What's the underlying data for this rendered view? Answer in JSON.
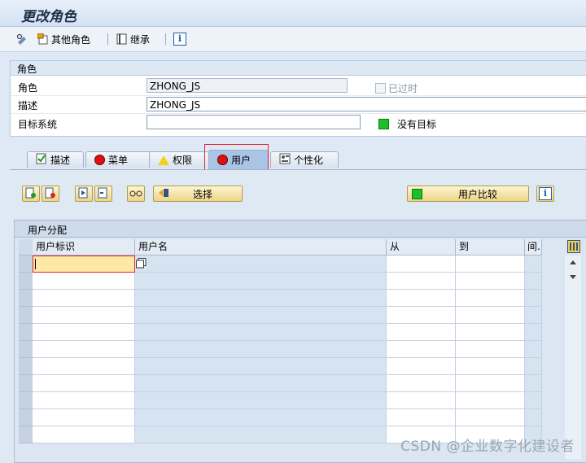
{
  "window": {
    "title": "更改角色"
  },
  "toolbar": {
    "other_role_label": "其他角色",
    "inherit_label": "继承",
    "icons": [
      "display-change-icon",
      "other-role-icon",
      "inherit-icon",
      "info-icon"
    ]
  },
  "role_section": {
    "header": "角色",
    "role_label": "角色",
    "role_value": "ZHONG_JS",
    "obsolete_label": "已过时",
    "desc_label": "描述",
    "desc_value": "ZHONG_JS",
    "target_label": "目标系统",
    "target_value": "",
    "no_target_label": "没有目标",
    "status_color": "#1ec02a"
  },
  "tabs": [
    {
      "label": "描述",
      "icon": "document-check-icon"
    },
    {
      "label": "菜单",
      "icon": "red-light-icon"
    },
    {
      "label": "权限",
      "icon": "warning-icon"
    },
    {
      "label": "用户",
      "icon": "red-light-icon",
      "active": true
    },
    {
      "label": "个性化",
      "icon": "personalize-icon"
    }
  ],
  "user_tab": {
    "select_button": "选择",
    "compare_button": "用户比较"
  },
  "user_assignment": {
    "header": "用户分配",
    "columns": [
      "用户标识",
      "用户名",
      "从",
      "到",
      "间."
    ],
    "rows": [
      [
        "",
        "",
        "",
        "",
        ""
      ],
      [
        "",
        "",
        "",
        "",
        ""
      ],
      [
        "",
        "",
        "",
        "",
        ""
      ],
      [
        "",
        "",
        "",
        "",
        ""
      ],
      [
        "",
        "",
        "",
        "",
        ""
      ],
      [
        "",
        "",
        "",
        "",
        ""
      ],
      [
        "",
        "",
        "",
        "",
        ""
      ],
      [
        "",
        "",
        "",
        "",
        ""
      ],
      [
        "",
        "",
        "",
        "",
        ""
      ],
      [
        "",
        "",
        "",
        "",
        ""
      ],
      [
        "",
        "",
        "",
        "",
        ""
      ]
    ]
  },
  "watermark": "CSDN @企业数字化建设者"
}
